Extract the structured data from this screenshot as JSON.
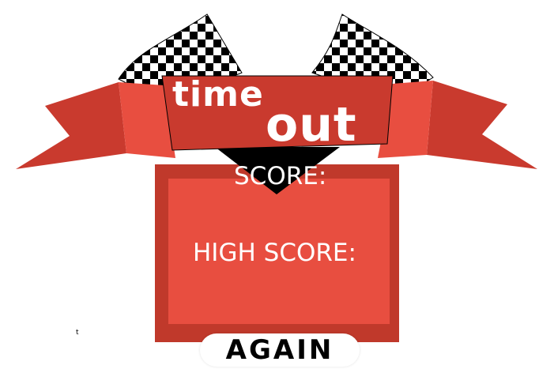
{
  "title": {
    "line1": "time",
    "line2": "out"
  },
  "panel": {
    "score_label": "SCORE:",
    "high_score_label": "HIGH SCORE:"
  },
  "buttons": {
    "again_label": "AGAIN"
  },
  "misc": {
    "stray_text": "t"
  },
  "colors": {
    "banner_red": "#c93a2e",
    "light_red": "#e84e40",
    "dark_red": "#c0392b",
    "checker_black": "#000000",
    "checker_white": "#ffffff",
    "text_white": "#ffffff"
  },
  "icons": [
    "checkered-flag-left-icon",
    "checkered-flag-right-icon",
    "ribbon-left-icon",
    "ribbon-right-icon",
    "pennant-down-icon"
  ]
}
